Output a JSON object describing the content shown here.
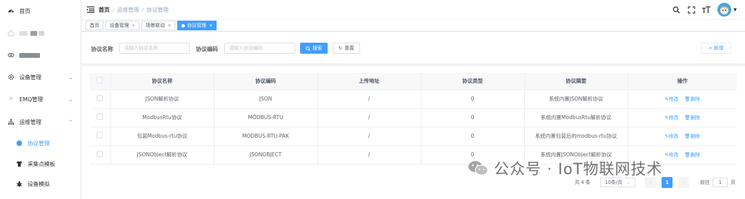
{
  "sidebar": {
    "items": [
      {
        "label": "首页",
        "icon": "dashboard-icon"
      },
      {
        "label": "",
        "icon": "home-icon"
      },
      {
        "label": "",
        "icon": "eye-icon"
      },
      {
        "label": "设备管理",
        "icon": "cog-icon"
      },
      {
        "label": "EMQ管理",
        "icon": "cross-icon"
      },
      {
        "label": "运维管理",
        "icon": "tree-icon"
      },
      {
        "label": "协议管理",
        "icon": "dot-icon"
      },
      {
        "label": "采集点模板",
        "icon": "shirt-icon"
      },
      {
        "label": "设备模拟",
        "icon": "bug-icon"
      }
    ]
  },
  "header": {
    "breadcrumb": [
      "首页",
      "运维管理",
      "协议管理"
    ]
  },
  "tags": [
    {
      "label": "首页",
      "closable": false
    },
    {
      "label": "设备管理",
      "closable": true
    },
    {
      "label": "场景联动",
      "closable": true
    },
    {
      "label": "协议管理",
      "closable": true,
      "active": true
    }
  ],
  "search": {
    "name_label": "协议名称",
    "name_placeholder": "请输入协议名称",
    "code_label": "协议编码",
    "code_placeholder": "请输入协议编码",
    "search_btn": "搜索",
    "reset_btn": "重置",
    "add_btn": "+ 新增"
  },
  "table": {
    "headers": [
      "协议名称",
      "协议编码",
      "上传地址",
      "协议类型",
      "协议摘要",
      "操作"
    ],
    "rows": [
      {
        "name": "JSON解析协议",
        "code": "JSON",
        "url": "/",
        "type": "0",
        "desc": "系统内置JSON解析协议"
      },
      {
        "name": "ModbusRtu协议",
        "code": "MODBUS-RTU",
        "url": "/",
        "type": "0",
        "desc": "系统内置ModbusRtu解析协议"
      },
      {
        "name": "包装Modbus-rtu协议",
        "code": "MODBUS-RTU-PAK",
        "url": "/",
        "type": "0",
        "desc": "系统内置包装后的modbus-rtu协议"
      },
      {
        "name": "JSONObject解析协议",
        "code": "JSONOBJECT",
        "url": "/",
        "type": "0",
        "desc": "系统内置JSONObject解析协议"
      }
    ],
    "edit_label": "修改",
    "delete_label": "删除"
  },
  "pager": {
    "total": "共 4 条",
    "size": "10条/页",
    "current": "1",
    "goto_label": "前往",
    "goto_value": "1",
    "page_suffix": "页"
  },
  "watermark": "公众号 · IoT物联网技术",
  "colors": {
    "accent": "#409eff"
  }
}
